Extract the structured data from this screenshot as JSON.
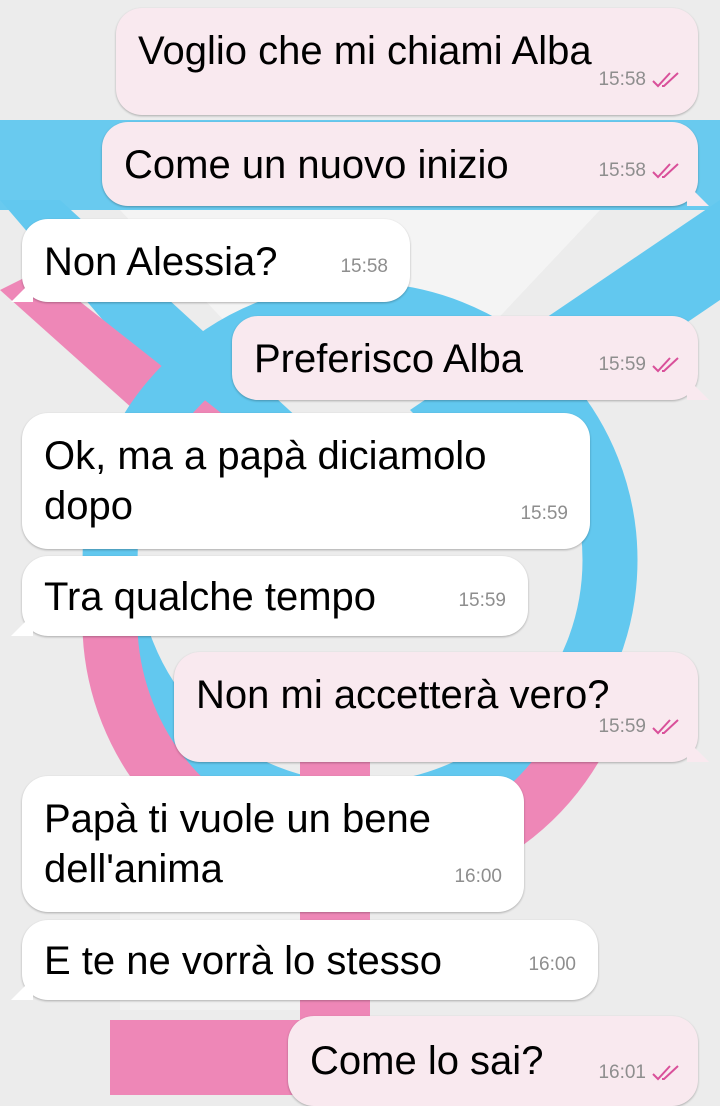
{
  "colors": {
    "outgoing_bubble": "#f9e9ef",
    "incoming_bubble": "#ffffff",
    "read_ticks": "#d9509a",
    "wallpaper_blue": "#62c8ef",
    "wallpaper_pink": "#ee87b7"
  },
  "wallpaper": {
    "icon": "transgender-symbol-icon"
  },
  "messages": [
    {
      "direction": "out",
      "text": "Voglio che mi chiami Alba",
      "time": "15:58",
      "status": "read-ticks-icon"
    },
    {
      "direction": "out",
      "text": "Come un nuovo inizio",
      "time": "15:58",
      "status": "read-ticks-icon"
    },
    {
      "direction": "in",
      "text": "Non Alessia?",
      "time": "15:58"
    },
    {
      "direction": "out",
      "text": "Preferisco Alba",
      "time": "15:59",
      "status": "read-ticks-icon"
    },
    {
      "direction": "in",
      "text": "Ok, ma a papà diciamolo\ndopo",
      "time": "15:59"
    },
    {
      "direction": "in",
      "text": "Tra qualche tempo",
      "time": "15:59"
    },
    {
      "direction": "out",
      "text": "Non mi accetterà vero?",
      "time": "15:59",
      "status": "read-ticks-icon"
    },
    {
      "direction": "in",
      "text": "Papà ti vuole un bene\ndell'anima",
      "time": "16:00"
    },
    {
      "direction": "in",
      "text": "E te ne vorrà lo stesso",
      "time": "16:00"
    },
    {
      "direction": "out",
      "text": "Come lo sai?",
      "time": "16:01",
      "status": "read-ticks-icon"
    }
  ]
}
